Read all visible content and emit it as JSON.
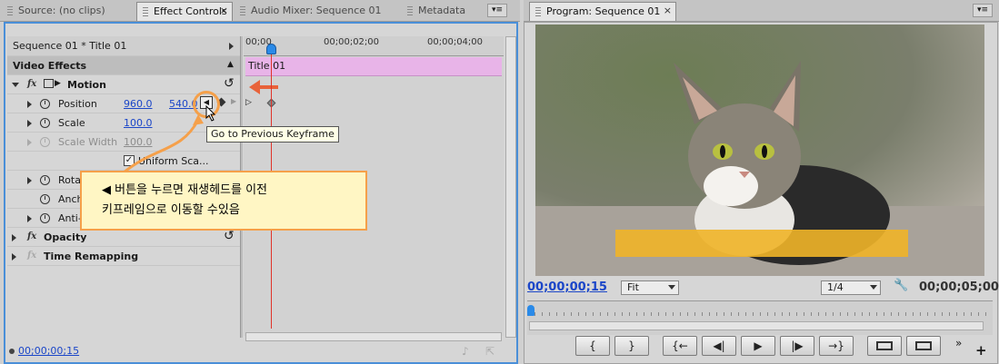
{
  "left_tabs": [
    {
      "label": "Source: (no clips)",
      "active": false
    },
    {
      "label": "Effect Controls",
      "active": true
    },
    {
      "label": "Audio Mixer: Sequence 01",
      "active": false
    },
    {
      "label": "Metadata",
      "active": false
    }
  ],
  "effect_controls": {
    "header": "Sequence 01 * Title 01",
    "section_title": "Video Effects",
    "motion_label": "Motion",
    "position_label": "Position",
    "position_x": "960.0",
    "position_y": "540.0",
    "scale_label": "Scale",
    "scale_value": "100.0",
    "scale_width_label": "Scale Width",
    "scale_width_value": "100.0",
    "uniform_scale_label": "Uniform Sca...",
    "rotation_label": "Rotat",
    "anchor_label": "Anch",
    "antiflicker_label": "Anti-f",
    "opacity_label": "Opacity",
    "time_remap_label": "Time Remapping",
    "timecode": "00;00;00;15",
    "ruler_labels": [
      "00;00",
      "00;00;02;00",
      "00;00;04;00"
    ],
    "clip_label": "Title 01",
    "tooltip": "Go to Previous Keyframe",
    "callout_line1": "◀  버튼을 누르면 재생헤드를 이전",
    "callout_line2": "키프레임으로 이동할 수있음"
  },
  "program_monitor": {
    "tab_label": "Program: Sequence 01",
    "timecode_current": "00;00;00;15",
    "fit_label": "Fit",
    "resolution": "1/4",
    "timecode_duration": "00;00;05;00",
    "transport_buttons": [
      "{",
      "}",
      "{←",
      "◀|",
      "▶",
      "|▶",
      "→}",
      "",
      ""
    ]
  },
  "colors": {
    "accent_blue": "#4a8fd8",
    "callout_border": "#f5a04a",
    "callout_bg": "#fff6c4",
    "clip_pink": "#e8b4e8",
    "playhead_red": "#e0332a",
    "timecode_blue": "#1b46c8",
    "title_bar_orange": "#f0b428"
  }
}
